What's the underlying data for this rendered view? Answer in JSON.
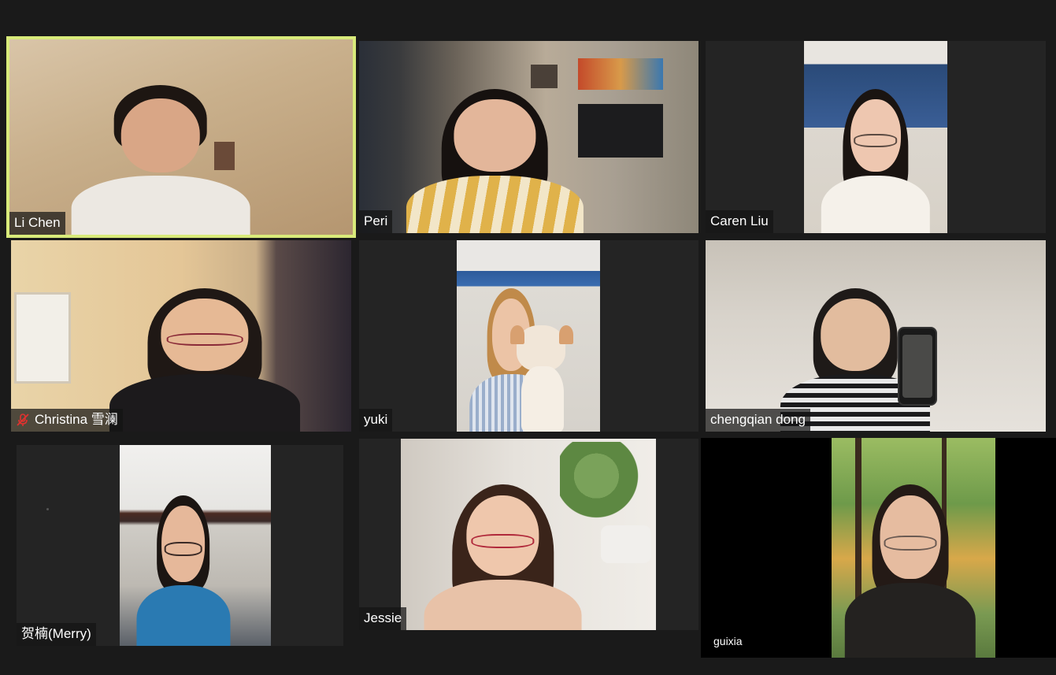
{
  "participants": [
    {
      "name": "Li Chen",
      "active_speaker": true
    },
    {
      "name": "Peri",
      "active_speaker": false
    },
    {
      "name": "Caren Liu",
      "active_speaker": false
    },
    {
      "name": "Christina 雪澜",
      "active_speaker": false,
      "muted": true
    },
    {
      "name": "yuki",
      "active_speaker": false
    },
    {
      "name": "chengqian dong",
      "active_speaker": false
    },
    {
      "name": "贺楠(Merry)",
      "active_speaker": false
    },
    {
      "name": "Jessie",
      "active_speaker": false
    },
    {
      "name": "guixia",
      "active_speaker": false
    }
  ],
  "colors": {
    "background": "#1a1a1a",
    "tile_background": "#242424",
    "active_speaker_border": "#d8ea7a",
    "name_label_text": "#ffffff",
    "muted_icon": "#e0322f"
  },
  "icons": {
    "muted": "mic-muted-icon"
  }
}
